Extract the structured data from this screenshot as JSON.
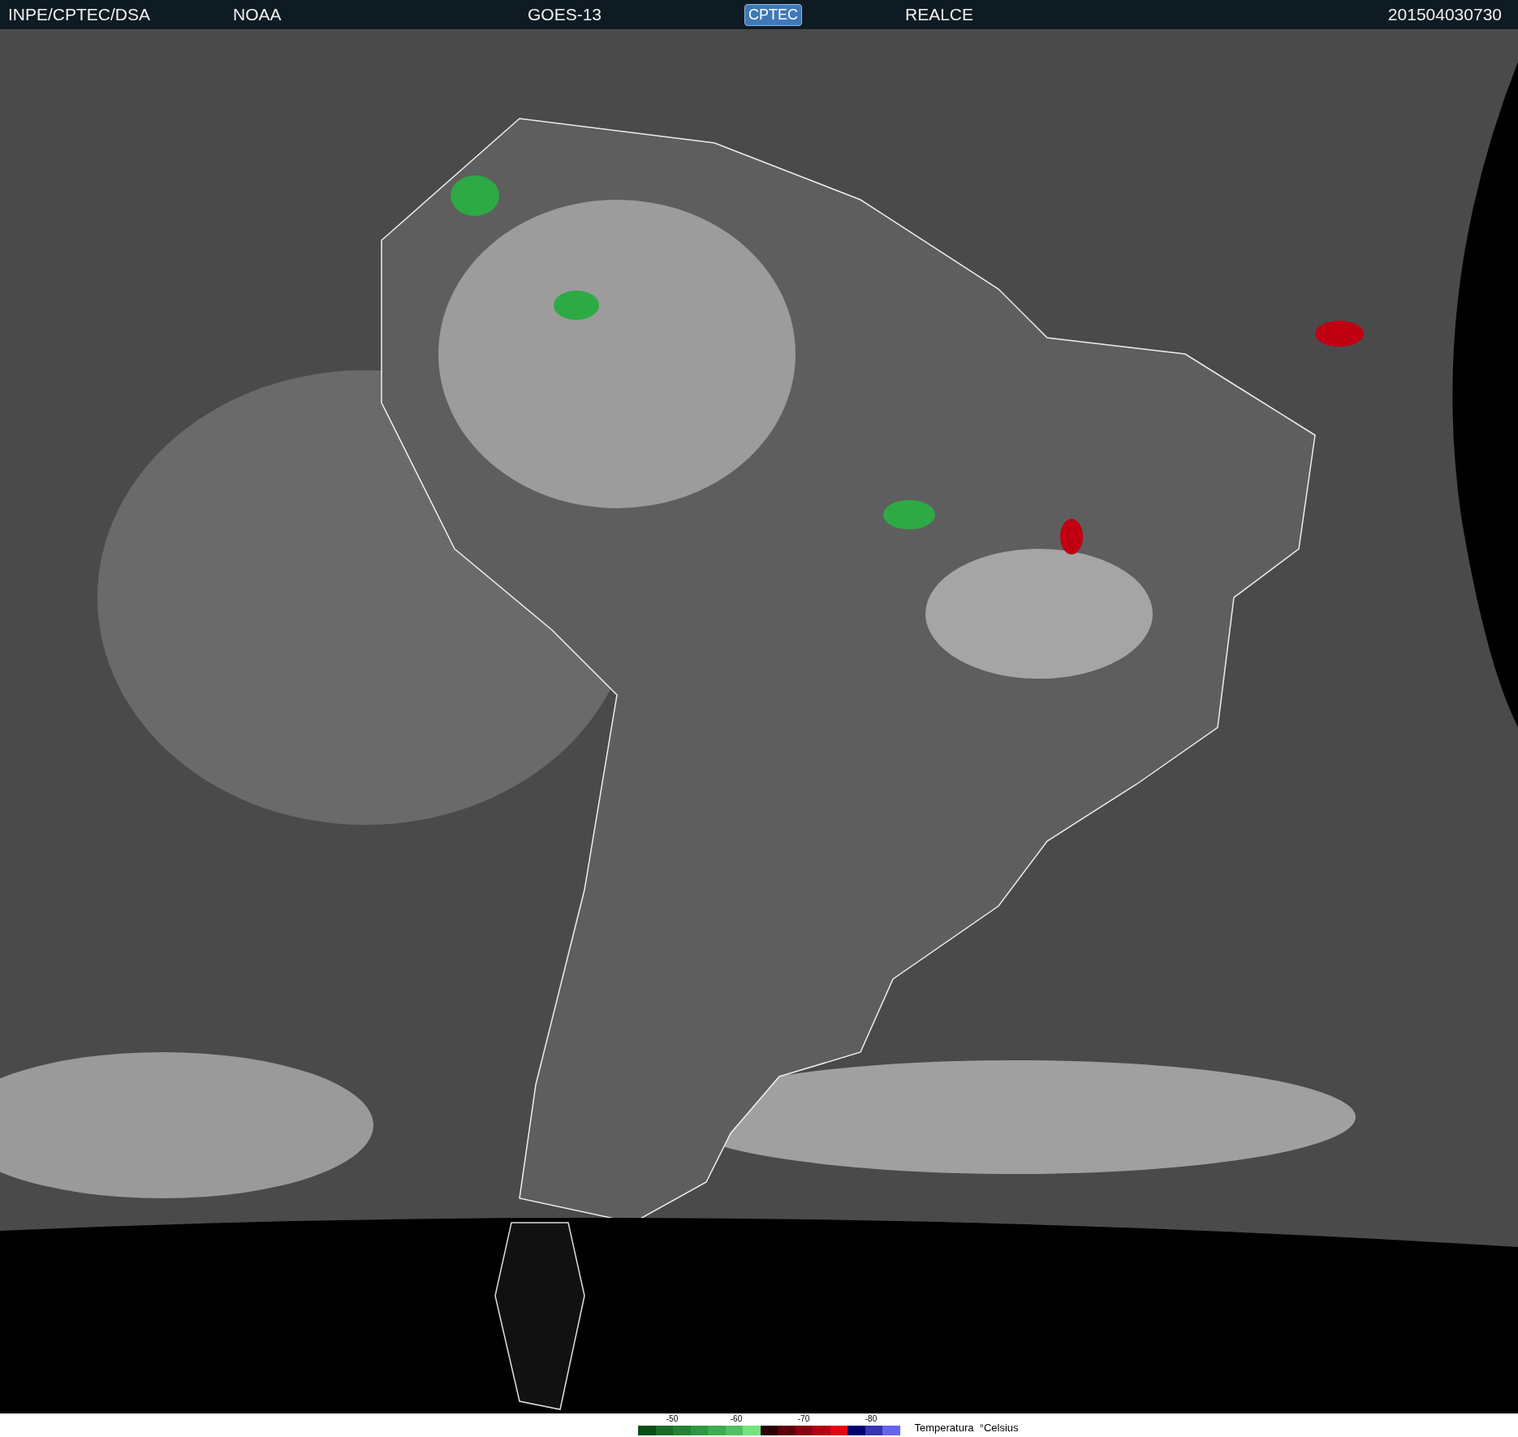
{
  "header": {
    "source": "INPE/CPTEC/DSA",
    "agency": "NOAA",
    "satellite": "GOES-13",
    "logo": "CPTEC",
    "product": "REALCE",
    "timestamp": "201504030730"
  },
  "legend": {
    "title": "Temperatura  °Celsius",
    "ticks": [
      {
        "label": "-50"
      },
      {
        "label": "-60"
      },
      {
        "label": "-70"
      },
      {
        "label": "-80"
      }
    ],
    "swatches": [
      {
        "color": "#0b4d16"
      },
      {
        "color": "#1a6b26"
      },
      {
        "color": "#238333"
      },
      {
        "color": "#2f9741"
      },
      {
        "color": "#3dab4e"
      },
      {
        "color": "#50c062"
      },
      {
        "color": "#74e47e"
      },
      {
        "color": "#2a0006"
      },
      {
        "color": "#5c000a"
      },
      {
        "color": "#8c0010"
      },
      {
        "color": "#b40012"
      },
      {
        "color": "#e80012"
      },
      {
        "color": "#00006e"
      },
      {
        "color": "#3434b4"
      },
      {
        "color": "#6464f0"
      }
    ]
  }
}
